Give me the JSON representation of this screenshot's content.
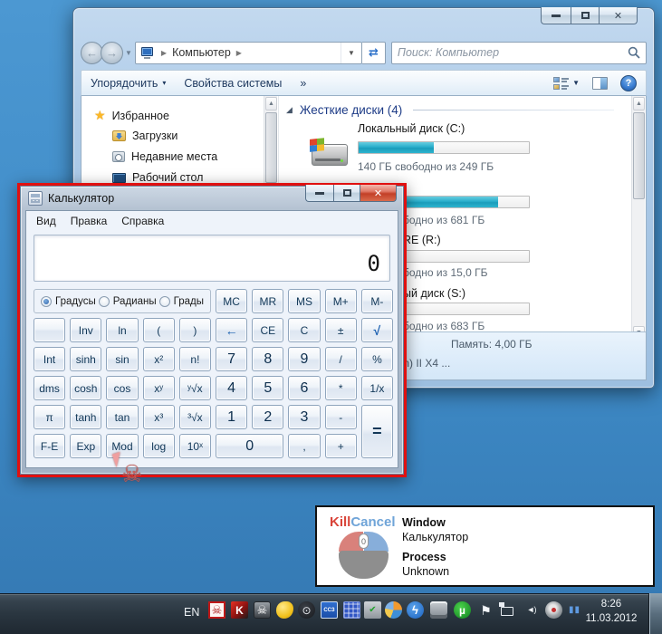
{
  "explorer": {
    "breadcrumb_root": "Компьютер",
    "search_placeholder": "Поиск: Компьютер",
    "close_glyph": "✕",
    "toolbar": {
      "organize": "Упорядочить",
      "organize_caret": "▾",
      "system_properties": "Свойства системы",
      "more": "»"
    },
    "nav_items": [
      "Избранное",
      "Загрузки",
      "Недавние места",
      "Рабочий стол"
    ],
    "content": {
      "group_header": "Жесткие диски (4)",
      "group_arrow": "◢",
      "drives": [
        {
          "name": "Локальный диск (C:)",
          "info": "140 ГБ свободно из 249 ГБ",
          "used_pct": 44
        },
        {
          "name": "",
          "info": "бодно из 681 ГБ",
          "used_pct": 82
        },
        {
          "name": "RE (R:)",
          "info": "бодно из 15,0 ГБ",
          "used_pct": 22
        },
        {
          "name": "ый диск (S:)",
          "info": "бодно из 683 ГБ",
          "used_pct": 22
        }
      ],
      "details": {
        "memory": "Память: 4,00 ГБ",
        "cpu_fragment": "m) II X4 ..."
      }
    }
  },
  "calculator": {
    "title": "Калькулятор",
    "close_glyph": "✕",
    "menu": [
      "Вид",
      "Правка",
      "Справка"
    ],
    "display": "0",
    "angle_units": {
      "options": [
        "Градусы",
        "Радианы",
        "Грады"
      ],
      "selected": "Градусы"
    },
    "memory_keys": [
      "MC",
      "MR",
      "MS",
      "M+",
      "M-"
    ],
    "keys": {
      "r2": [
        "",
        "Inv",
        "ln",
        "(",
        ")",
        "←",
        "CE",
        "C",
        "±",
        "√"
      ],
      "r3": [
        "Int",
        "sinh",
        "sin",
        "x²",
        "n!",
        "7",
        "8",
        "9",
        "/",
        "%"
      ],
      "r4": [
        "dms",
        "cosh",
        "cos",
        "xʸ",
        "ʸ√x",
        "4",
        "5",
        "6",
        "*",
        "1/x"
      ],
      "r5": [
        "π",
        "tanh",
        "tan",
        "x³",
        "³√x",
        "1",
        "2",
        "3",
        "-",
        "="
      ],
      "r6": [
        "F-E",
        "Exp",
        "Mod",
        "log",
        "10ˣ",
        "0",
        ",",
        "+"
      ]
    }
  },
  "killcancel": {
    "kill": "Kill",
    "cancel": "Cancel",
    "mouse_badge": "0",
    "window_label": "Window",
    "window_value": "Калькулятор",
    "process_label": "Process",
    "process_value": "Unknown"
  },
  "taskbar": {
    "language": "EN",
    "time": "8:26",
    "date": "11.03.2012",
    "tray": [
      {
        "name": "killcancel-skull",
        "glyph": "☠"
      },
      {
        "name": "kaspersky",
        "glyph": "K"
      },
      {
        "name": "skull-app",
        "glyph": "☠"
      },
      {
        "name": "clock-yellow",
        "glyph": ""
      },
      {
        "name": "steam",
        "glyph": "⊙"
      },
      {
        "name": "cc3",
        "glyph": "ССЗ"
      },
      {
        "name": "blue-grid",
        "glyph": ""
      },
      {
        "name": "usb-safely-remove",
        "glyph": "✔"
      },
      {
        "name": "color-swirl",
        "glyph": ""
      },
      {
        "name": "lightning",
        "glyph": "ϟ"
      },
      {
        "name": "input-device",
        "glyph": ""
      },
      {
        "name": "utorrent",
        "glyph": "µ"
      },
      {
        "name": "action-center-flag",
        "glyph": "⚑"
      },
      {
        "name": "network",
        "glyph": ""
      },
      {
        "name": "volume",
        "glyph": "◄)"
      },
      {
        "name": "recorder",
        "glyph": ""
      },
      {
        "name": "blue-bars",
        "glyph": "▮▮"
      }
    ]
  },
  "cursor": {
    "skull_glyph": "☠"
  },
  "colors": {
    "highlight_red": "#e01010",
    "progress_fill": "#2fb4cf",
    "desktop_blue": "#3e8ac6"
  }
}
